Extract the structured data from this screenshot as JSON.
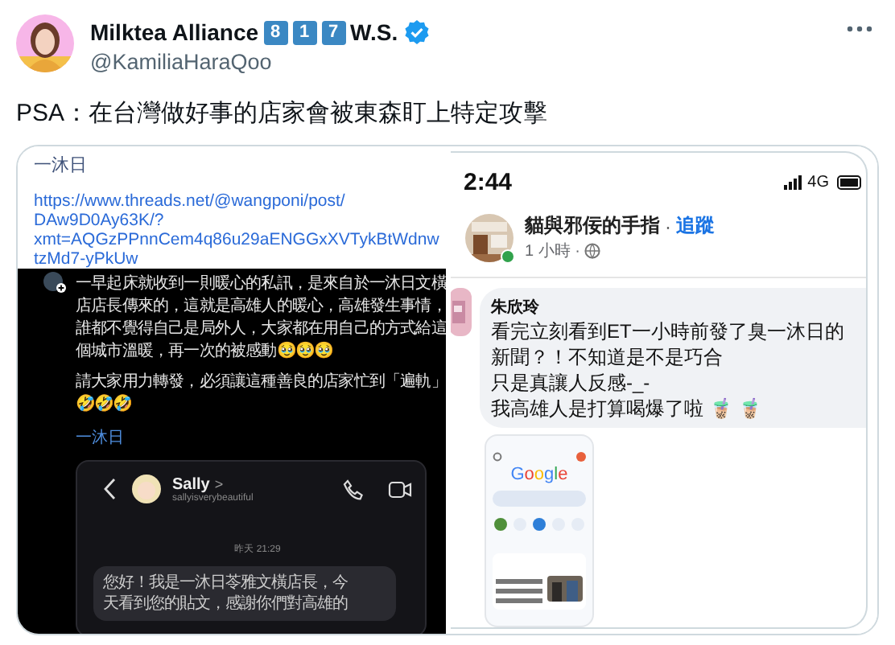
{
  "author": {
    "name": "Milktea Alliance",
    "badges": [
      "8",
      "1",
      "7"
    ],
    "suffix": "W.S.",
    "verified": true,
    "handle": "@KamiliaHaraQoo"
  },
  "tweet_text": "PSA：在台灣做好事的店家會被東森盯上特定攻擊",
  "media": [
    {
      "kind": "threads",
      "header": "一沐日",
      "url_lines": [
        "https://www.threads.net/@wangponi/post/",
        "DAw9D0Ay63K/?",
        "xmt=AQGzPPnnCem4q86u29aENGGxXVTykBtWdnw",
        "tzMd7-yPkUw"
      ],
      "paragraphs": [
        {
          "lines": [
            "一早起床就收到一則暖心的私訊，是來自於一沐日文橫",
            "店店長傳來的，這就是高雄人的暖心，高雄發生事情，",
            "誰都不覺得自己是局外人，大家都在用自己的方式給這",
            "個城市溫暖，再一次的被感動🥹🥹🥹"
          ]
        },
        {
          "lines": [
            "請大家用力轉發，必須讓這種善良的店家忙到「遍軌」",
            "🤣🤣🤣"
          ]
        }
      ],
      "tag": "一沐日",
      "dm": {
        "contact": "Sally",
        "chevron": ">",
        "username": "sallyisverybeautiful",
        "date": "昨天 21:29",
        "message_lines": [
          "您好！我是一沐日苓雅文橫店長，今",
          "天看到您的貼文，感謝你們對高雄的"
        ]
      }
    },
    {
      "kind": "facebook",
      "time": "2:44",
      "network": "4G",
      "page_name": "貓與邪佞的手指",
      "separator": "·",
      "follow": "追蹤",
      "post_age": "1 小時 ·",
      "online": true,
      "comment": {
        "author": "朱欣玲",
        "lines": [
          "看完立刻看到ET一小時前發了臭一沐日的",
          "新聞？！不知道是不是巧合",
          "只是真讓人反感-_-",
          "我高雄人是打算喝爆了啦 🧋 🧋"
        ]
      },
      "thumbnail": {
        "logo": "Google"
      }
    }
  ]
}
